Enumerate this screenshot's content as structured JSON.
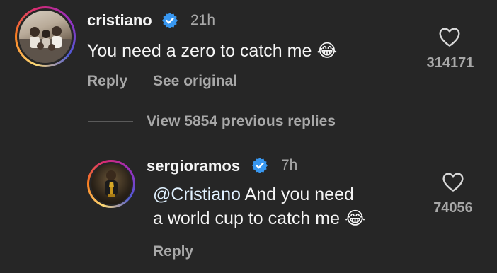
{
  "comment": {
    "username": "cristiano",
    "time": "21h",
    "text": "You need a zero to catch me",
    "emoji": "😂",
    "reply_label": "Reply",
    "see_original_label": "See original",
    "like_count": "314171"
  },
  "view_replies": {
    "label": "View 5854 previous replies"
  },
  "reply": {
    "username": "sergioramos",
    "time": "7h",
    "mention": "@Cristiano",
    "text_line1": " And you need",
    "text_line2": "a world cup to catch me",
    "emoji": "😂",
    "reply_label": "Reply",
    "like_count": "74056"
  },
  "colors": {
    "background": "#262626",
    "verified": "#3897f0",
    "secondary_text": "#a8a8a8"
  }
}
